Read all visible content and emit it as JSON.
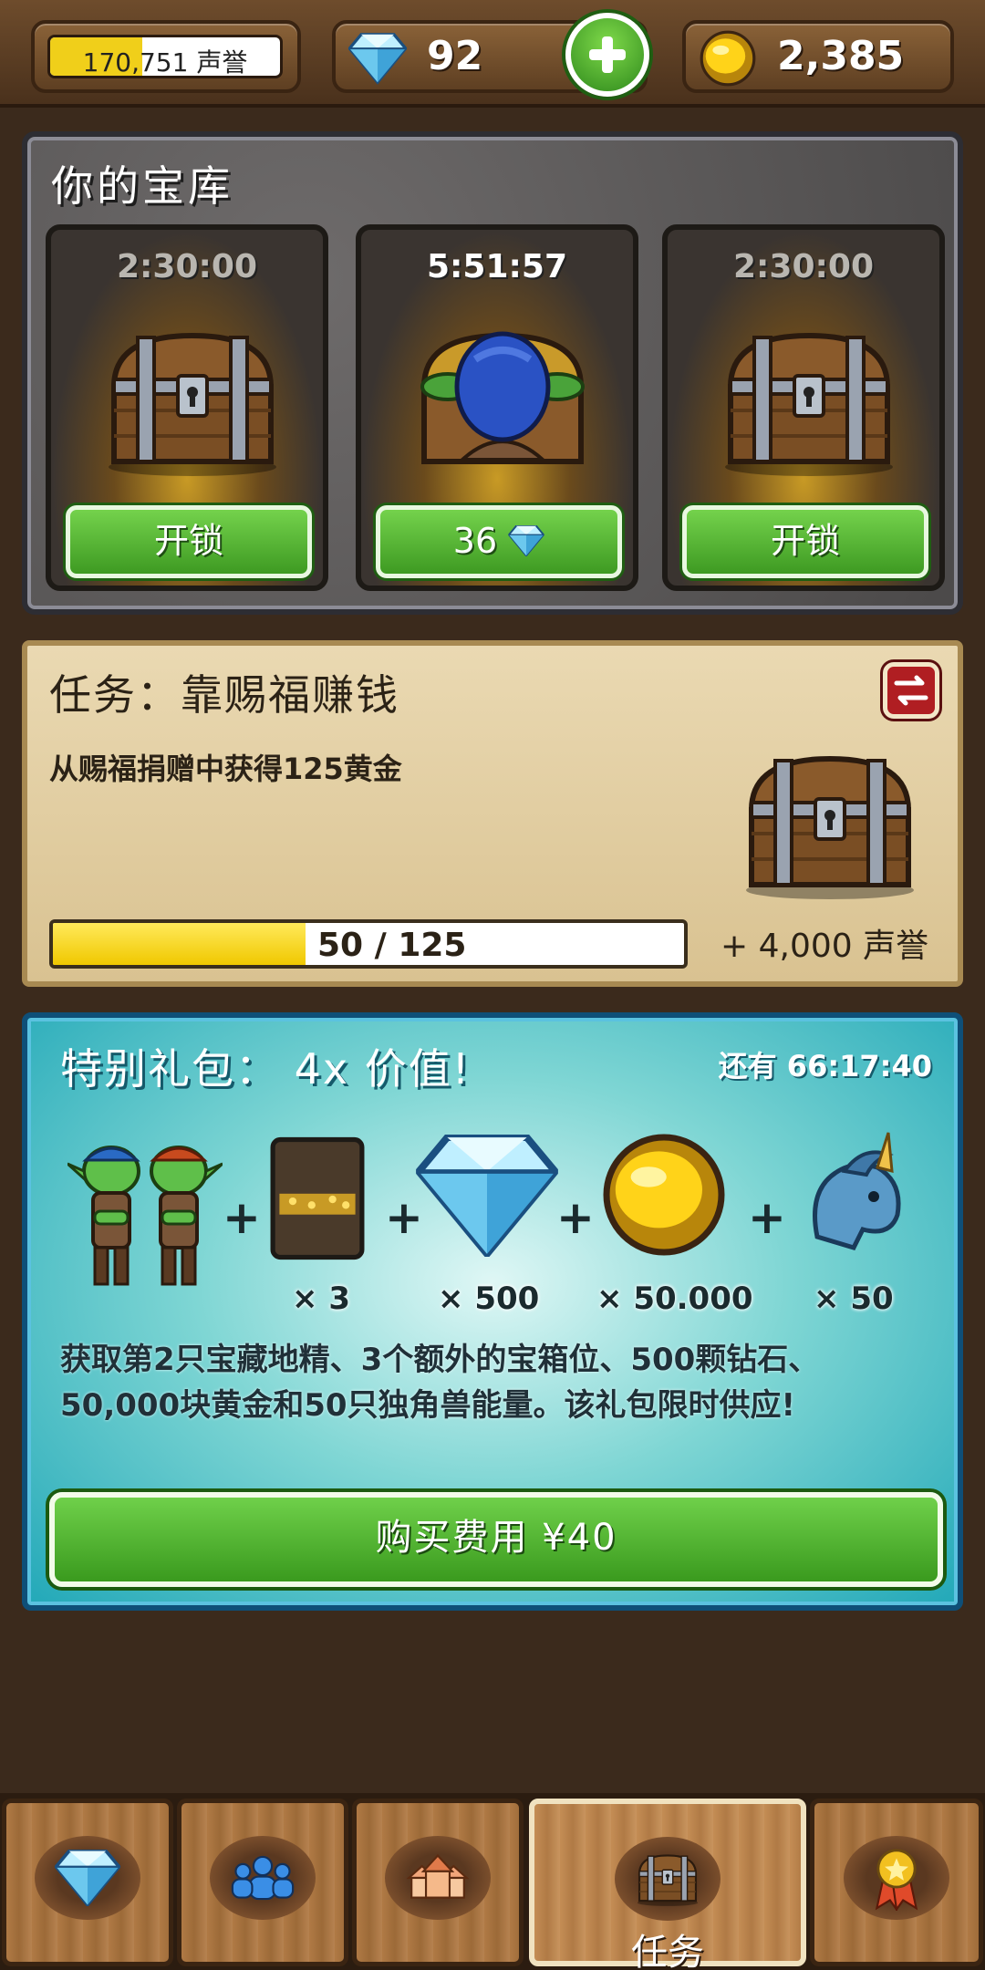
{
  "topbar": {
    "reputation_text": "170,751 声誉",
    "reputation_fill_fraction": 0.4,
    "gems": "92",
    "gold": "2,385"
  },
  "vault": {
    "title": "你的宝库",
    "slots": [
      {
        "timer": "2:30:00",
        "button": "开锁"
      },
      {
        "timer": "5:51:57",
        "button": "36"
      },
      {
        "timer": "2:30:00",
        "button": "开锁"
      }
    ]
  },
  "quest": {
    "title": "任务：靠赐福赚钱",
    "description": "从赐福捐赠中获得125黄金",
    "progress_text": "50 / 125",
    "progress_value": 50,
    "progress_max": 125,
    "reward": "+ 4,000 声誉"
  },
  "offer": {
    "title": "特别礼包： 4x 价值!",
    "timer": "还有 66:17:40",
    "items": [
      {
        "icon": "goblin-pair-icon",
        "qty": ""
      },
      {
        "icon": "chest-slot-icon",
        "qty": "× 3"
      },
      {
        "icon": "diamond-icon",
        "qty": "× 500"
      },
      {
        "icon": "gold-coin-icon",
        "qty": "× 50.000"
      },
      {
        "icon": "unicorn-icon",
        "qty": "× 50"
      }
    ],
    "description": "获取第2只宝藏地精、3个额外的宝箱位、500颗钻石、50,000块黄金和50只独角兽能量。该礼包限时供应!",
    "buy_label": "购买费用 ¥40"
  },
  "nav": {
    "tabs": [
      {
        "icon": "gems-icon",
        "label": ""
      },
      {
        "icon": "people-icon",
        "label": ""
      },
      {
        "icon": "houses-icon",
        "label": ""
      },
      {
        "icon": "chest-icon",
        "label": "任务",
        "active": true
      },
      {
        "icon": "medal-icon",
        "label": ""
      }
    ]
  },
  "colors": {
    "accent_green": "#4cb52c",
    "gold_yellow": "#f0c800",
    "offer_blue": "#22a8b8",
    "background": "#3b2a1c"
  }
}
